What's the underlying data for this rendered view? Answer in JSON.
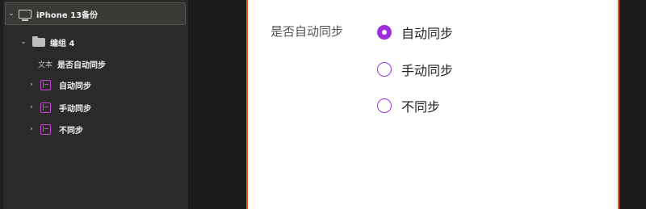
{
  "layers": {
    "root": {
      "label": "iPhone 13备份",
      "icon": "device-icon"
    },
    "group": {
      "label": "编组 4",
      "icon": "folder-icon"
    },
    "items": [
      {
        "type": "文本",
        "label": "是否自动同步"
      },
      {
        "type": "component",
        "label": "自动同步"
      },
      {
        "type": "component",
        "label": "手动同步"
      },
      {
        "type": "component",
        "label": "不同步"
      }
    ]
  },
  "canvas": {
    "question": "是否自动同步",
    "options": [
      {
        "label": "自动同步",
        "selected": true
      },
      {
        "label": "手动同步",
        "selected": false
      },
      {
        "label": "不同步",
        "selected": false
      }
    ],
    "accent": "#9f2ee0",
    "artboard_border": "#e8571d"
  }
}
